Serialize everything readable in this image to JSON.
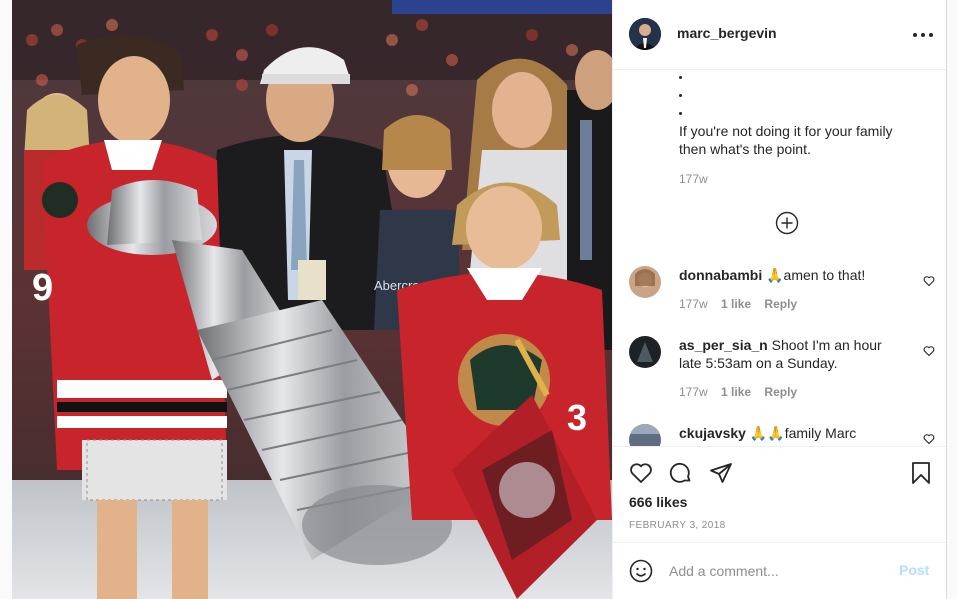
{
  "post": {
    "username": "marc_bergevin",
    "caption_dots": [
      "•",
      "•",
      "•"
    ],
    "caption_line1": "If you're not doing it for your family",
    "caption_line2": "then what's the point.",
    "caption_time": "177w",
    "likes": "666 likes",
    "date": "FEBRUARY 3, 2018"
  },
  "comments": [
    {
      "username": "donnabambi",
      "text_line1": "🙏amen to that!",
      "text_line2": "",
      "time": "177w",
      "likes": "1 like",
      "reply": "Reply"
    },
    {
      "username": "as_per_sia_n",
      "text_line1": "Shoot I'm an hour",
      "text_line2": "late 5:53am on a Sunday.",
      "time": "177w",
      "likes": "1 like",
      "reply": "Reply"
    },
    {
      "username": "ckujavsky",
      "text_line1": "🙏🙏family Marc",
      "text_line2": "",
      "time": "",
      "likes": "",
      "reply": ""
    }
  ],
  "photo_jersey_text": {
    "shirt_text": "Abercrombie",
    "numbers_left": "9",
    "numbers_right": "3"
  },
  "add_comment": {
    "placeholder": "Add a comment...",
    "post_label": "Post"
  },
  "icons": {
    "more": "more-horizontal-icon",
    "load_more": "plus-circle-icon",
    "like": "heart-icon",
    "comment": "comment-bubble-icon",
    "share": "paper-plane-icon",
    "save": "bookmark-icon",
    "emoji": "smiley-icon"
  },
  "colors": {
    "text": "#262626",
    "muted": "#8e8e8e",
    "border": "#efefef",
    "post_disabled": "#b2dffc",
    "jersey_red": "#c8242c"
  }
}
